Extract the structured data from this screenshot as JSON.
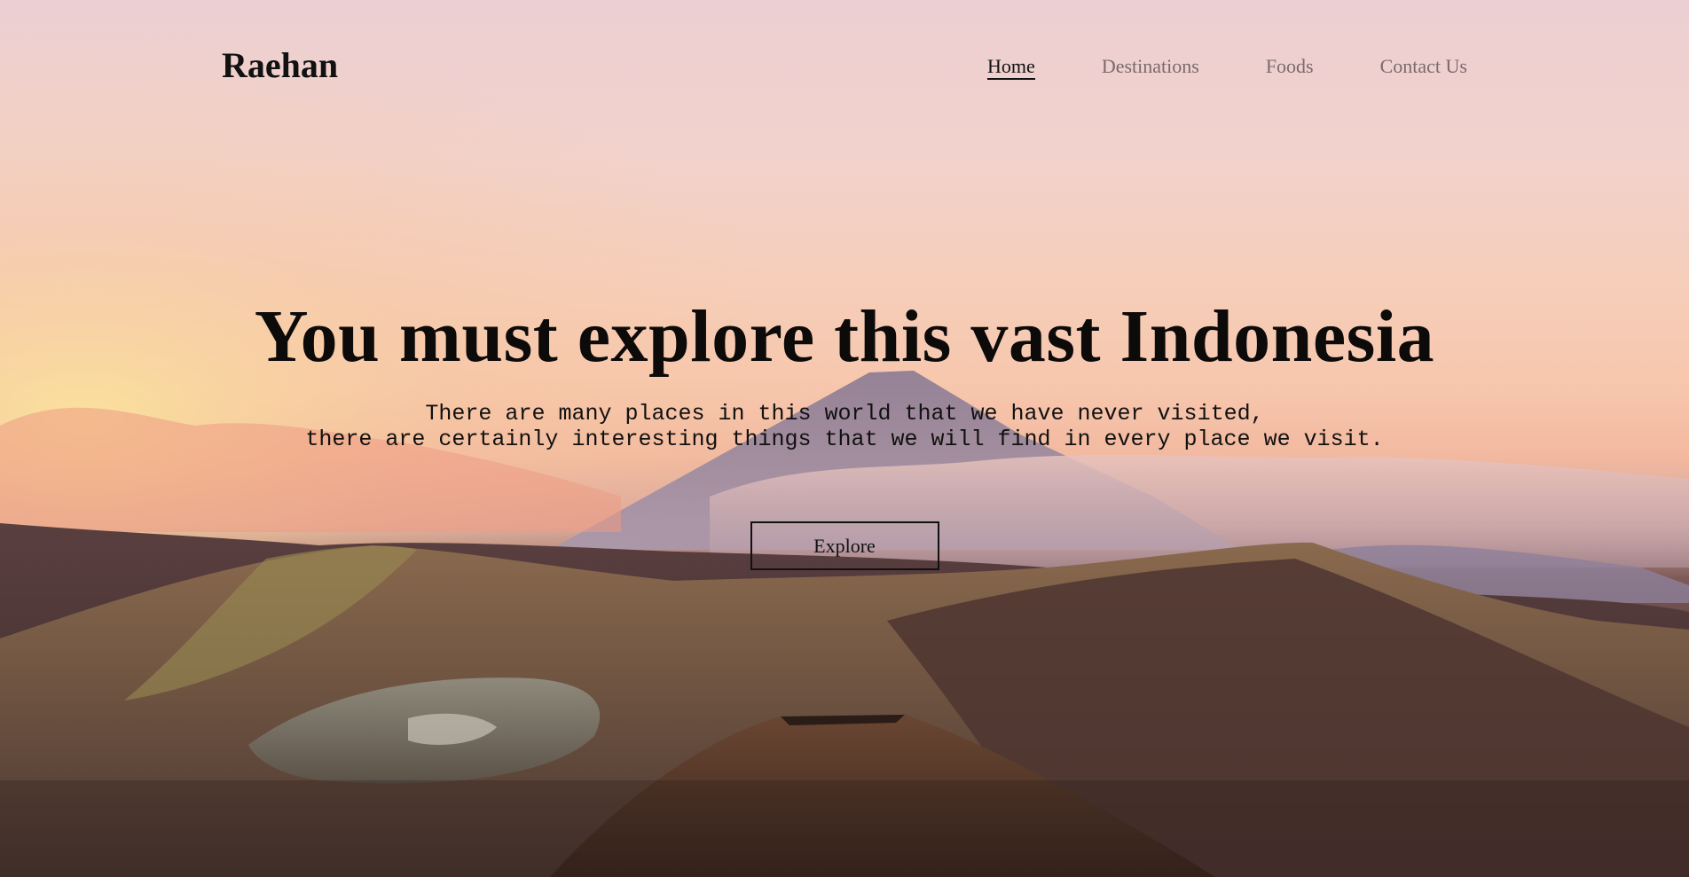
{
  "brand": {
    "name": "Raehan"
  },
  "nav": {
    "items": [
      {
        "label": "Home",
        "active": true
      },
      {
        "label": "Destinations",
        "active": false
      },
      {
        "label": "Foods",
        "active": false
      },
      {
        "label": "Contact Us",
        "active": false
      }
    ]
  },
  "hero": {
    "headline": "You must explore this vast Indonesia",
    "subtitle_line1": "There are many places in this world that we have never visited,",
    "subtitle_line2": "there are certainly interesting things that we will find in every place we visit.",
    "cta_label": "Explore"
  },
  "colors": {
    "sky_top": "#eccfd2",
    "sky_glow": "#f7c7ad",
    "mountain_dark": "#2f2220",
    "text": "#111111",
    "nav_muted": "#7a6a6a"
  }
}
